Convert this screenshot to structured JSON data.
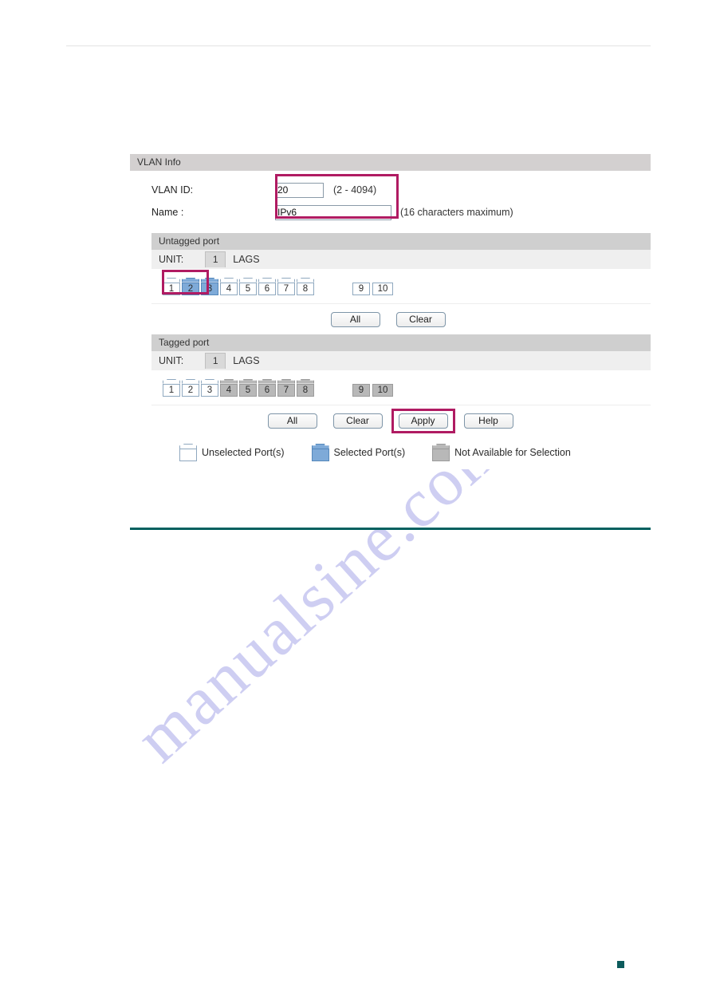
{
  "page": {
    "watermark_text": "manualsine.com",
    "accent_rule_color": "#00605f",
    "highlight_color": "#b01b62",
    "selected_port_color": "#7eaad8",
    "unavailable_port_color": "#b8b8b8"
  },
  "panel": {
    "vlan_info": {
      "header": "VLAN Info",
      "fields": [
        {
          "label": "VLAN ID:",
          "value": "20",
          "placeholder": "",
          "hint": "(2 - 4094)"
        },
        {
          "label": "Name :",
          "value": "IPv6",
          "placeholder": "",
          "hint": "(16 characters maximum)"
        }
      ]
    },
    "untagged": {
      "header": "Untagged port",
      "unit_label": "UNIT:",
      "unit_value": "1",
      "lags_label": "LAGS",
      "ports": [
        {
          "number": "1",
          "state": "unsel"
        },
        {
          "number": "2",
          "state": "sel"
        },
        {
          "number": "3",
          "state": "sel"
        },
        {
          "number": "4",
          "state": "unsel"
        },
        {
          "number": "5",
          "state": "unsel"
        },
        {
          "number": "6",
          "state": "unsel"
        },
        {
          "number": "7",
          "state": "unsel"
        },
        {
          "number": "8",
          "state": "unsel"
        }
      ],
      "lags": [
        {
          "number": "9",
          "state": "unsel"
        },
        {
          "number": "10",
          "state": "unsel"
        }
      ],
      "buttons": [
        {
          "label": "All",
          "highlighted": false
        },
        {
          "label": "Clear",
          "highlighted": false
        }
      ]
    },
    "tagged": {
      "header": "Tagged port",
      "unit_label": "UNIT:",
      "unit_value": "1",
      "lags_label": "LAGS",
      "ports": [
        {
          "number": "1",
          "state": "unsel"
        },
        {
          "number": "2",
          "state": "unsel"
        },
        {
          "number": "3",
          "state": "unsel"
        },
        {
          "number": "4",
          "state": "na"
        },
        {
          "number": "5",
          "state": "na"
        },
        {
          "number": "6",
          "state": "na"
        },
        {
          "number": "7",
          "state": "na"
        },
        {
          "number": "8",
          "state": "na"
        }
      ],
      "lags": [
        {
          "number": "9",
          "state": "na"
        },
        {
          "number": "10",
          "state": "na"
        }
      ],
      "buttons": [
        {
          "label": "All",
          "highlighted": false
        },
        {
          "label": "Clear",
          "highlighted": false
        },
        {
          "label": "Apply",
          "highlighted": true
        },
        {
          "label": "Help",
          "highlighted": false
        }
      ]
    },
    "legend": [
      {
        "state": "unsel",
        "text": "Unselected Port(s)"
      },
      {
        "state": "sel",
        "text": "Selected Port(s)"
      },
      {
        "state": "na",
        "text": "Not Available for Selection"
      }
    ]
  }
}
